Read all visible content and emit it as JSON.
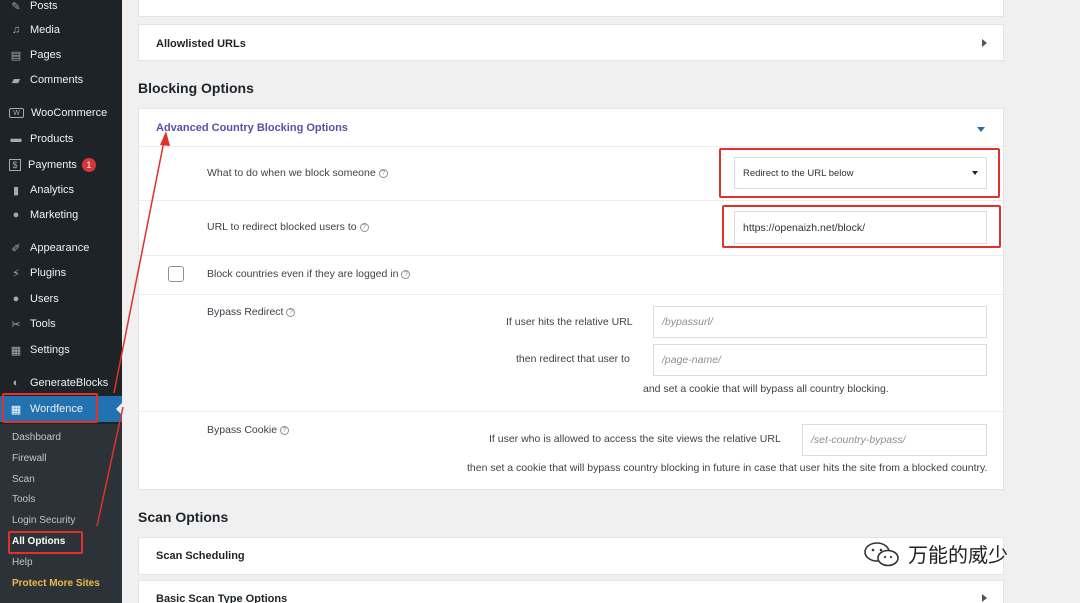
{
  "sidebar": {
    "items": [
      {
        "label": "Posts",
        "icon": "pin-icon"
      },
      {
        "label": "Media",
        "icon": "media-icon"
      },
      {
        "label": "Pages",
        "icon": "page-icon"
      },
      {
        "label": "Comments",
        "icon": "comment-icon"
      },
      {
        "label": "WooCommerce",
        "icon": "woo-icon"
      },
      {
        "label": "Products",
        "icon": "archive-icon"
      },
      {
        "label": "Payments",
        "icon": "dollar-icon",
        "badge": "1"
      },
      {
        "label": "Analytics",
        "icon": "bar-chart-icon"
      },
      {
        "label": "Marketing",
        "icon": "megaphone-icon"
      },
      {
        "label": "Appearance",
        "icon": "brush-icon"
      },
      {
        "label": "Plugins",
        "icon": "plug-icon"
      },
      {
        "label": "Users",
        "icon": "user-icon"
      },
      {
        "label": "Tools",
        "icon": "wrench-icon"
      },
      {
        "label": "Settings",
        "icon": "settings-icon"
      },
      {
        "label": "GenerateBlocks",
        "icon": "blocks-icon"
      },
      {
        "label": "Wordfence",
        "icon": "wordfence-icon"
      }
    ],
    "submenu": [
      {
        "label": "Dashboard"
      },
      {
        "label": "Firewall"
      },
      {
        "label": "Scan"
      },
      {
        "label": "Tools"
      },
      {
        "label": "Login Security"
      },
      {
        "label": "All Options"
      },
      {
        "label": "Help"
      },
      {
        "label": "Protect More Sites"
      }
    ]
  },
  "main": {
    "allowlisted_title": "Allowlisted URLs",
    "blocking_heading": "Blocking Options",
    "advanced_title": "Advanced Country Blocking Options",
    "what_to_do_label": "What to do when we block someone",
    "what_to_do_value": "Redirect to the URL below",
    "redirect_url_label": "URL to redirect blocked users to",
    "redirect_url_value": "https://openaizh.net/block/",
    "block_logged_in_label": "Block countries even if they are logged in",
    "bypass_redirect_label": "Bypass Redirect",
    "bypass_relative_label": "If user hits the relative URL",
    "bypass_relative_placeholder": "/bypassurl/",
    "bypass_then_label": "then redirect that user to",
    "bypass_then_placeholder": "/page-name/",
    "bypass_cookie_note": "and set a cookie that will bypass all country blocking.",
    "bypass_cookie_label": "Bypass Cookie",
    "cookie_relative_label": "If user who is allowed to access the site views the relative URL",
    "cookie_relative_placeholder": "/set-country-bypass/",
    "cookie_note": "then set a cookie that will bypass country blocking in future in case that user hits the site from a blocked country.",
    "scan_heading": "Scan Options",
    "scan_scheduling_title": "Scan Scheduling",
    "basic_scan_title": "Basic Scan Type Options"
  },
  "watermark": {
    "text": "万能的威少"
  },
  "colors": {
    "sidebar_bg": "#1d2327",
    "accent_blue": "#2271b1",
    "highlight_red": "#e0312b",
    "link_purple": "#5b4fa8"
  }
}
